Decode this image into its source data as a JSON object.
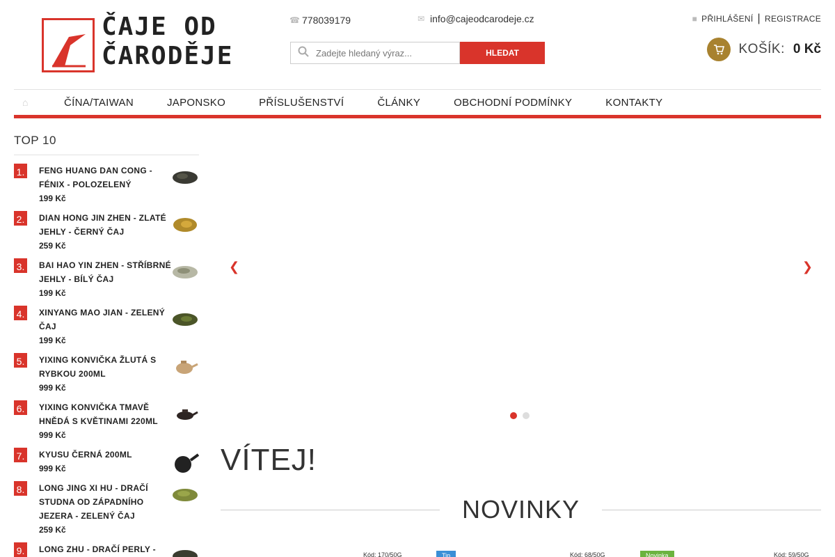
{
  "header": {
    "logo_line1": "ČAJE OD",
    "logo_line2": "ČARODĚJE",
    "phone": "778039179",
    "email": "info@cajeodcarodeje.cz",
    "search_placeholder": "Zadejte hledaný výraz...",
    "search_button": "HLEDAT",
    "login": "PŘIHLÁŠENÍ",
    "separator": "|",
    "register": "REGISTRACE",
    "cart_label": "KOŠÍK:",
    "cart_total": "0 Kč",
    "icons": {
      "phone": "phone-icon",
      "email": "envelope-icon",
      "search": "search-icon",
      "user": "user-icon",
      "cart": "cart-icon"
    }
  },
  "nav": {
    "items": [
      "ČÍNA/TAIWAN",
      "JAPONSKO",
      "PŘÍSLUŠENSTVÍ",
      "ČLÁNKY",
      "OBCHODNÍ PODMÍNKY",
      "KONTAKTY"
    ]
  },
  "sidebar": {
    "title": "TOP 10",
    "items": [
      {
        "rank": "1.",
        "name": "FENG HUANG DAN CONG - FÉNIX - POLOZELENÝ",
        "price": "199 Kč"
      },
      {
        "rank": "2.",
        "name": "DIAN HONG JIN ZHEN - ZLATÉ JEHLY - ČERNÝ ČAJ",
        "price": "259 Kč"
      },
      {
        "rank": "3.",
        "name": "BAI HAO YIN ZHEN - STŘÍBRNÉ JEHLY - BÍLÝ ČAJ",
        "price": "199 Kč"
      },
      {
        "rank": "4.",
        "name": "XINYANG MAO JIAN - ZELENÝ ČAJ",
        "price": "199 Kč"
      },
      {
        "rank": "5.",
        "name": "YIXING KONVIČKA ŽLUTÁ S RYBKOU 200ML",
        "price": "999 Kč"
      },
      {
        "rank": "6.",
        "name": "YIXING KONVIČKA TMAVĚ HNĚDÁ S KVĚTINAMI 220ML",
        "price": "999 Kč"
      },
      {
        "rank": "7.",
        "name": "KYUSU ČERNÁ 200ML",
        "price": "999 Kč"
      },
      {
        "rank": "8.",
        "name": "LONG JING XI HU - DRAČÍ STUDNA OD ZÁPADNÍHO JEZERA - ZELENÝ ČAJ",
        "price": "259 Kč"
      },
      {
        "rank": "9.",
        "name": "LONG ZHU - DRAČÍ PERLY -",
        "price": ""
      }
    ]
  },
  "slider": {
    "slides": 2,
    "active": 1
  },
  "main": {
    "welcome": "VÍTEJ!",
    "new_title": "NOVINKY",
    "products": [
      {
        "code": "Kód: 170/50G",
        "badge": ""
      },
      {
        "code": "Kód: 68/50G",
        "badge": "Tip"
      },
      {
        "code": "Kód: 59/50G",
        "badge": "Novinka"
      }
    ]
  },
  "colors": {
    "accent": "#d9342b",
    "cart": "#a8822f",
    "tip": "#3a8fd6",
    "new": "#6cb33f"
  }
}
